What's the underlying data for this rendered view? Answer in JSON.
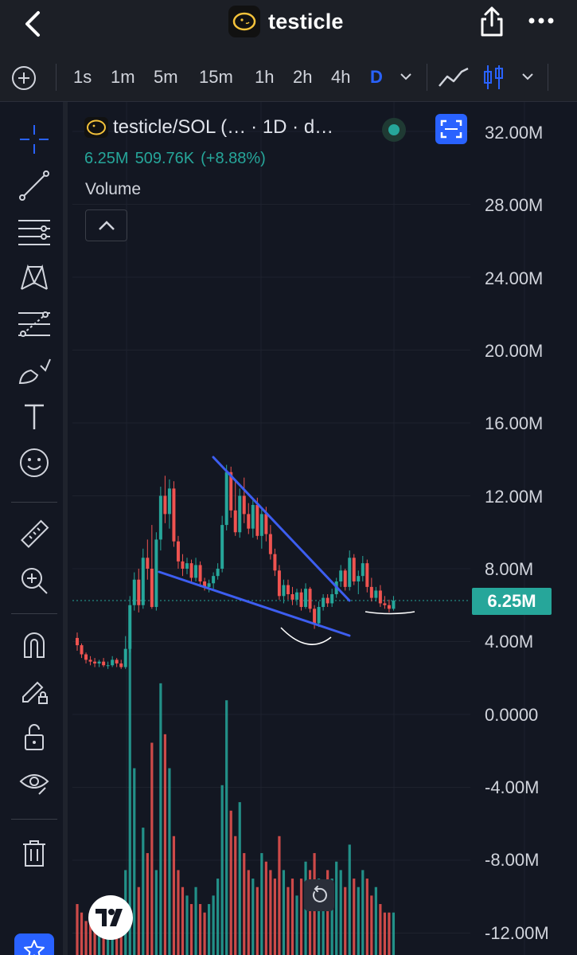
{
  "header": {
    "title": "testicle",
    "icons": [
      "back-arrow-icon",
      "token-logo",
      "share-icon",
      "more-icon"
    ]
  },
  "timeframes": {
    "items": [
      "1s",
      "1m",
      "5m",
      "15m",
      "1h",
      "2h",
      "4h",
      "D"
    ],
    "active": "D",
    "icons": [
      "add-indicator-icon",
      "line-chart-icon",
      "candlestick-icon",
      "chevron-down-icon"
    ]
  },
  "toolbar": {
    "icons": [
      "crosshair-icon",
      "trend-line-icon",
      "horizontal-lines-icon",
      "pattern-icon",
      "fib-retracement-icon",
      "brush-icon",
      "text-icon",
      "emoji-icon",
      "ruler-icon",
      "zoom-in-icon",
      "magnet-icon",
      "lock-drawing-icon",
      "unlock-icon",
      "eye-icon",
      "trash-icon",
      "favorites-star-icon"
    ]
  },
  "legend": {
    "symbol": "testicle/SOL (…",
    "interval": "· 1D · d…",
    "last": "6.25M",
    "change": "509.76K",
    "change_pct": "(+8.88%)",
    "volume_label": "Volume"
  },
  "price_axis": [
    "32.00M",
    "28.00M",
    "24.00M",
    "20.00M",
    "16.00M",
    "12.00M",
    "8.00M",
    "4.00M",
    "0.0000",
    "-4.00M",
    "-8.00M",
    "-12.00M"
  ],
  "last_price_label": "6.25M",
  "colors": {
    "background": "#131722",
    "up": "#26a69a",
    "down": "#ef5350",
    "accent": "#2962ff",
    "trendline": "#3d5ef0"
  },
  "chart_data": {
    "type": "candlestick",
    "interval": "1D",
    "y_unit": "M",
    "ylim": [
      -12.8,
      33
    ],
    "last_price": 6.25,
    "candles": [
      [
        4.2,
        4.5,
        3.5,
        3.8
      ],
      [
        3.8,
        3.9,
        3.1,
        3.3
      ],
      [
        3.3,
        3.4,
        2.8,
        3.0
      ],
      [
        3.0,
        3.2,
        2.7,
        2.9
      ],
      [
        2.9,
        3.1,
        2.6,
        2.8
      ],
      [
        2.8,
        3.0,
        2.6,
        2.9
      ],
      [
        2.9,
        3.1,
        2.6,
        2.7
      ],
      [
        2.7,
        2.9,
        2.5,
        2.7
      ],
      [
        2.7,
        3.2,
        2.6,
        3.0
      ],
      [
        3.0,
        3.1,
        2.6,
        2.8
      ],
      [
        2.8,
        3.0,
        2.5,
        2.6
      ],
      [
        2.6,
        4.3,
        2.5,
        3.6
      ],
      [
        3.6,
        6.5,
        3.4,
        6.0
      ],
      [
        6.0,
        7.8,
        5.7,
        7.4
      ],
      [
        7.4,
        8.0,
        5.6,
        6.0
      ],
      [
        6.0,
        9.1,
        5.8,
        8.6
      ],
      [
        8.6,
        9.6,
        7.4,
        8.0
      ],
      [
        8.0,
        10.4,
        5.8,
        5.9
      ],
      [
        5.9,
        10.0,
        5.7,
        9.6
      ],
      [
        9.6,
        12.5,
        9.0,
        12.0
      ],
      [
        12.0,
        13.1,
        10.5,
        11.0
      ],
      [
        11.0,
        12.9,
        10.2,
        12.4
      ],
      [
        12.4,
        12.8,
        9.2,
        9.5
      ],
      [
        9.5,
        9.8,
        8.0,
        8.4
      ],
      [
        8.4,
        8.8,
        7.6,
        8.0
      ],
      [
        8.0,
        8.6,
        7.7,
        8.3
      ],
      [
        8.3,
        8.5,
        7.2,
        7.5
      ],
      [
        7.5,
        8.6,
        7.3,
        8.2
      ],
      [
        8.2,
        8.4,
        7.0,
        7.3
      ],
      [
        7.3,
        7.5,
        6.8,
        7.0
      ],
      [
        7.0,
        7.4,
        6.7,
        7.2
      ],
      [
        7.2,
        7.8,
        6.9,
        7.6
      ],
      [
        7.6,
        8.3,
        7.4,
        8.0
      ],
      [
        8.0,
        10.9,
        7.8,
        10.4
      ],
      [
        10.4,
        13.7,
        10.1,
        13.3
      ],
      [
        13.3,
        13.6,
        10.8,
        11.2
      ],
      [
        11.2,
        12.8,
        9.8,
        10.0
      ],
      [
        10.0,
        12.4,
        9.7,
        12.0
      ],
      [
        12.0,
        13.0,
        10.5,
        11.0
      ],
      [
        11.0,
        11.6,
        9.9,
        10.2
      ],
      [
        10.2,
        11.8,
        9.7,
        11.5
      ],
      [
        11.5,
        11.9,
        9.6,
        9.8
      ],
      [
        9.8,
        11.3,
        9.1,
        11.0
      ],
      [
        11.0,
        11.4,
        9.5,
        9.9
      ],
      [
        9.9,
        10.4,
        8.5,
        8.8
      ],
      [
        8.8,
        9.1,
        7.6,
        7.9
      ],
      [
        7.9,
        8.2,
        6.3,
        6.5
      ],
      [
        6.5,
        7.4,
        6.1,
        7.1
      ],
      [
        7.1,
        7.4,
        6.3,
        6.6
      ],
      [
        6.6,
        7.0,
        6.0,
        6.3
      ],
      [
        6.3,
        6.9,
        6.0,
        6.7
      ],
      [
        6.7,
        6.9,
        5.7,
        5.9
      ],
      [
        5.9,
        7.2,
        5.8,
        6.9
      ],
      [
        6.9,
        7.0,
        5.6,
        5.8
      ],
      [
        5.8,
        6.0,
        4.7,
        5.0
      ],
      [
        5.0,
        6.2,
        4.8,
        5.9
      ],
      [
        5.9,
        6.6,
        5.7,
        6.4
      ],
      [
        6.4,
        6.6,
        5.9,
        6.1
      ],
      [
        6.1,
        6.9,
        5.9,
        6.6
      ],
      [
        6.6,
        7.5,
        6.4,
        7.3
      ],
      [
        7.3,
        8.2,
        7.0,
        7.9
      ],
      [
        7.9,
        8.0,
        6.8,
        7.0
      ],
      [
        7.0,
        9.0,
        6.8,
        8.6
      ],
      [
        8.6,
        8.8,
        7.1,
        7.3
      ],
      [
        7.3,
        7.9,
        6.6,
        7.6
      ],
      [
        7.6,
        8.7,
        7.3,
        8.3
      ],
      [
        8.3,
        8.5,
        6.7,
        7.0
      ],
      [
        7.0,
        7.5,
        6.2,
        6.4
      ],
      [
        6.4,
        7.0,
        6.2,
        6.8
      ],
      [
        6.8,
        7.1,
        5.9,
        6.1
      ],
      [
        6.1,
        6.5,
        5.8,
        6.0
      ],
      [
        6.0,
        6.3,
        5.6,
        5.8
      ],
      [
        5.8,
        6.5,
        5.7,
        6.25
      ]
    ],
    "volume": [
      6,
      5,
      4,
      4,
      3,
      3,
      3,
      3,
      3,
      3,
      3,
      10,
      40,
      22,
      8,
      15,
      12,
      25,
      10,
      32,
      26,
      22,
      14,
      10,
      8,
      7,
      6,
      8,
      6,
      5,
      6,
      7,
      9,
      20,
      30,
      17,
      14,
      18,
      12,
      10,
      9,
      8,
      12,
      11,
      10,
      9,
      14,
      10,
      8,
      9,
      7,
      9,
      11,
      10,
      12,
      9,
      8,
      10,
      9,
      11,
      10,
      8,
      13,
      9,
      8,
      10,
      9,
      7,
      8,
      6,
      5,
      5,
      5
    ]
  }
}
